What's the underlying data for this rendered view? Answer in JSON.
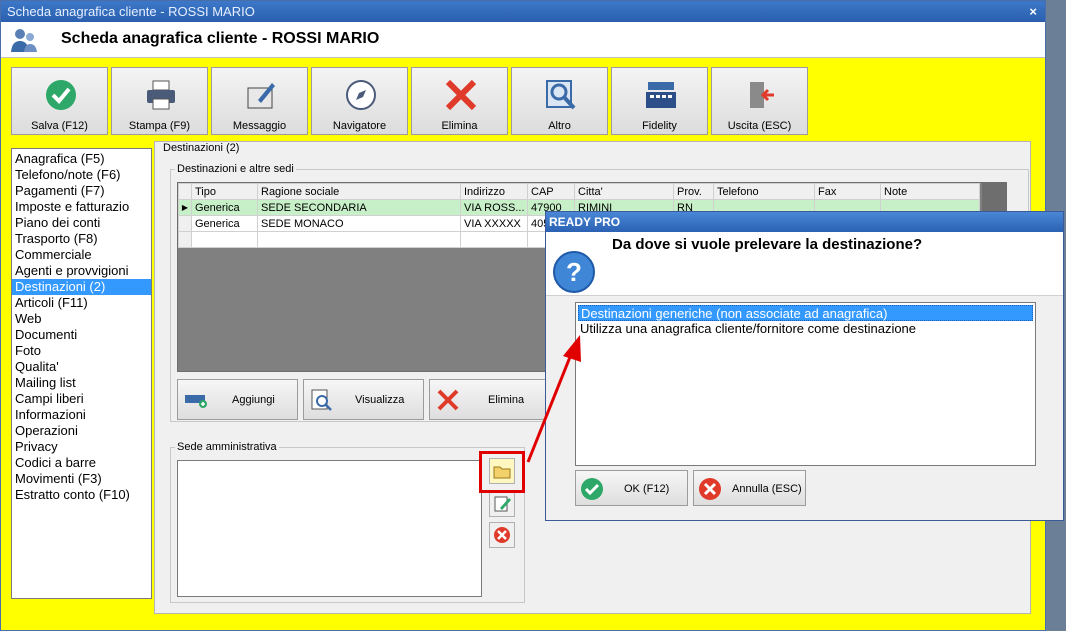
{
  "window": {
    "title": "Scheda anagrafica cliente - ROSSI MARIO",
    "close_label": "×",
    "header_title": "Scheda anagrafica cliente - ROSSI MARIO"
  },
  "toolbar": [
    {
      "label": "Salva (F12)",
      "icon": "check-circle-icon"
    },
    {
      "label": "Stampa (F9)",
      "icon": "printer-icon"
    },
    {
      "label": "Messaggio",
      "icon": "message-edit-icon"
    },
    {
      "label": "Navigatore",
      "icon": "compass-icon"
    },
    {
      "label": "Elimina",
      "icon": "red-x-icon"
    },
    {
      "label": "Altro",
      "icon": "magnifier-icon"
    },
    {
      "label": "Fidelity",
      "icon": "cash-register-icon"
    },
    {
      "label": "Uscita (ESC)",
      "icon": "exit-door-icon"
    }
  ],
  "nav": [
    "Anagrafica (F5)",
    "Telefono/note (F6)",
    "Pagamenti (F7)",
    "Imposte e fatturazio",
    "Piano dei conti",
    "Trasporto (F8)",
    "Commerciale",
    "Agenti e provvigioni",
    "Destinazioni (2)",
    "Articoli (F11)",
    "Web",
    "Documenti",
    "Foto",
    "Qualita'",
    "Mailing list",
    "Campi liberi",
    "Informazioni",
    "Operazioni",
    "Privacy",
    "Codici a barre",
    "Movimenti (F3)",
    "Estratto conto (F10)"
  ],
  "nav_selected": "Destinazioni (2)",
  "main": {
    "group_title": "Destinazioni (2)",
    "subgroup_title": "Destinazioni e altre sedi",
    "grid": {
      "columns": [
        "Tipo",
        "Ragione sociale",
        "Indirizzo",
        "CAP",
        "Citta'",
        "Prov.",
        "Telefono",
        "Fax",
        "Note"
      ],
      "rows": [
        [
          "Genericа",
          "SEDE SECONDARIA",
          "VIA ROSS...",
          "47900",
          "RIMINI",
          "RN",
          "",
          "",
          ""
        ],
        [
          "Generica",
          "SEDE MONACO",
          "VIA XXXXX",
          "405",
          "",
          "",
          "",
          "",
          ""
        ]
      ]
    },
    "actions": [
      {
        "label": "Aggiungi",
        "icon": "add-card-icon"
      },
      {
        "label": "Visualizza",
        "icon": "view-document-icon"
      },
      {
        "label": "Elimina",
        "icon": "red-x-icon"
      }
    ],
    "sede_title": "Sede amministrativa"
  },
  "dialog": {
    "title": "READY PRO",
    "question": "Da dove si vuole prelevare la destinazione?",
    "options": [
      "Destinazioni generiche (non associate ad anagrafica)",
      "Utilizza una anagrafica cliente/fornitore come destinazione"
    ],
    "ok_label": "OK (F12)",
    "cancel_label": "Annulla (ESC)"
  },
  "colors": {
    "window_bg": "#ffff00",
    "selection": "#3399ff",
    "row_highlight": "#c8f0c8",
    "annotation": "#e00000"
  }
}
